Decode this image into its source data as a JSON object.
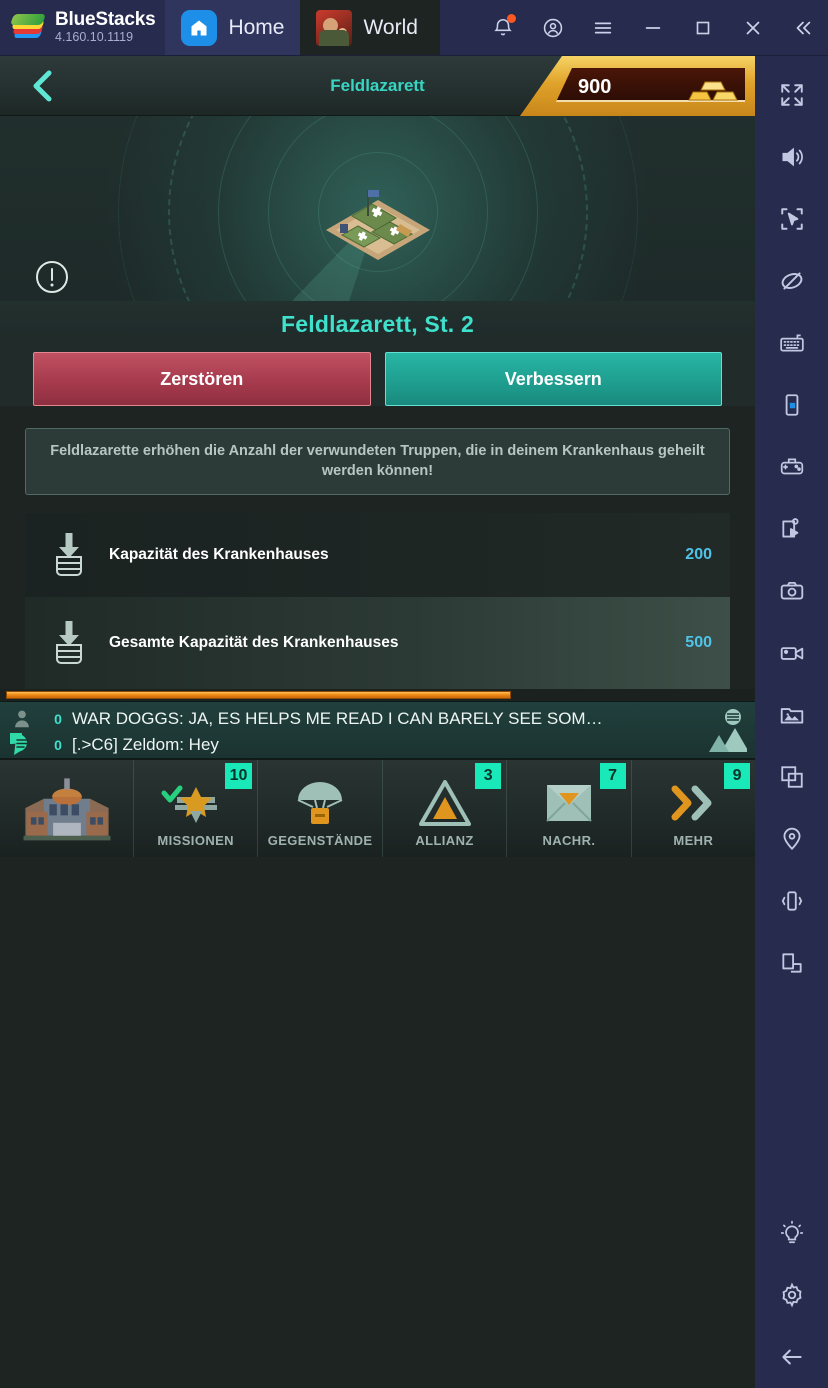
{
  "titlebar": {
    "brand_name": "BlueStacks",
    "version": "4.160.10.1119",
    "tabs": [
      {
        "label": "Home",
        "icon": "home-icon",
        "active": true
      },
      {
        "label": "World W",
        "icon": "game-icon",
        "active": false
      }
    ],
    "actions": [
      {
        "name": "notifications-icon",
        "label": "Notifications"
      },
      {
        "name": "account-icon",
        "label": "Account"
      },
      {
        "name": "menu-icon",
        "label": "Menu"
      },
      {
        "name": "minimize-icon",
        "label": "Minimize"
      },
      {
        "name": "maximize-icon",
        "label": "Maximize"
      },
      {
        "name": "close-icon",
        "label": "Close"
      },
      {
        "name": "collapse-icon",
        "label": "Collapse"
      }
    ]
  },
  "game": {
    "header": {
      "back_label": "Back",
      "title": "Feldlazarett",
      "gold_value": "900",
      "gold_icon": "gold-bars-icon"
    },
    "building": {
      "info_icon": "info-alert-icon",
      "name": "Feldlazarett, St. 2",
      "image": "field-hospital-building"
    },
    "buttons": {
      "destroy": "Zerstören",
      "upgrade": "Verbessern"
    },
    "description": "Feldlazarette erhöhen die Anzahl der verwundeten Truppen, die in deinem Krankenhaus geheilt werden können!",
    "stats": [
      {
        "icon": "capacity-icon",
        "label": "Kapazität des Krankenhauses",
        "value": "200"
      },
      {
        "icon": "capacity-icon",
        "label": "Gesamte Kapazität des Krankenhauses",
        "value": "500"
      }
    ],
    "chat": {
      "lines": [
        {
          "icon": "user-icon",
          "count": "0",
          "text": "WAR DOGGS: JA, ES HELPS ME READ I CAN BARELY SEE SOM…"
        },
        {
          "icon": "chat-bubble-icon",
          "count": "0",
          "text": "[.>C6] Zeldom: Hey"
        }
      ],
      "corner_icon": "chat-expand-icon"
    },
    "navbar": [
      {
        "name": "city-hall",
        "label": "",
        "icon": "city-hall-icon",
        "badge": ""
      },
      {
        "name": "missions",
        "label": "MISSIONEN",
        "icon": "missions-star-icon",
        "badge": "10"
      },
      {
        "name": "items",
        "label": "GEGENSTÄNDE",
        "icon": "parachute-crate-icon",
        "badge": ""
      },
      {
        "name": "alliance",
        "label": "ALLIANZ",
        "icon": "alliance-triangle-icon",
        "badge": "3"
      },
      {
        "name": "messages",
        "label": "NACHR.",
        "icon": "envelope-icon",
        "badge": "7"
      },
      {
        "name": "more",
        "label": "MEHR",
        "icon": "chevrons-right-icon",
        "badge": "9"
      }
    ]
  },
  "sidebar": {
    "items": [
      {
        "name": "fullscreen-icon",
        "label": "Fullscreen"
      },
      {
        "name": "volume-icon",
        "label": "Volume"
      },
      {
        "name": "cursor-select-icon",
        "label": "Cursor"
      },
      {
        "name": "eye-off-icon",
        "label": "Eye off"
      },
      {
        "name": "keyboard-icon",
        "label": "Keyboard controls"
      },
      {
        "name": "rotate-device-icon",
        "label": "Rotate"
      },
      {
        "name": "gamepad-icon",
        "label": "Gamepad"
      },
      {
        "name": "script-play-icon",
        "label": "Script"
      },
      {
        "name": "camera-icon",
        "label": "Screenshot"
      },
      {
        "name": "video-camera-icon",
        "label": "Record"
      },
      {
        "name": "gallery-icon",
        "label": "Media manager"
      },
      {
        "name": "multi-instance-icon",
        "label": "Multi-instance"
      },
      {
        "name": "location-pin-icon",
        "label": "Location"
      },
      {
        "name": "shake-icon",
        "label": "Shake"
      },
      {
        "name": "macro-icon",
        "label": "Macro"
      }
    ],
    "bottom_items": [
      {
        "name": "lightbulb-icon",
        "label": "Tips"
      },
      {
        "name": "gear-icon",
        "label": "Settings"
      },
      {
        "name": "back-arrow-icon",
        "label": "Back"
      }
    ]
  }
}
